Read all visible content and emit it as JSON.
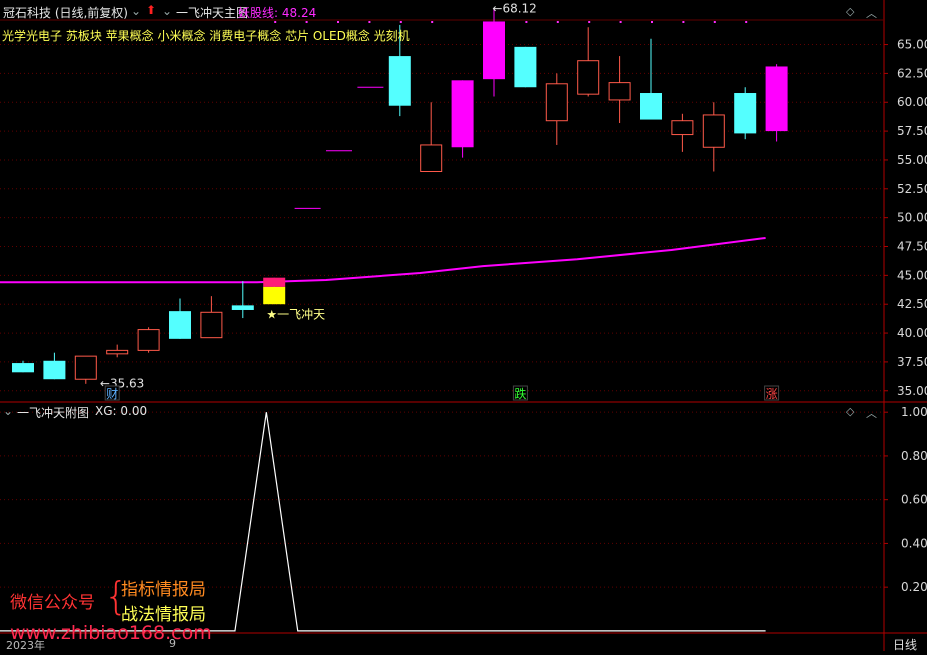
{
  "header": {
    "stock_title": "冠石科技 (日线,前复权)",
    "indicator_title": "一飞冲天主图",
    "indicator_value_label": "妖股线: 48.24",
    "concepts": "光学光电子 苏板块 苹果概念 小米概念 消费电子概念 芯片 OLED概念 光刻机",
    "sub_title": "一飞冲天附图",
    "sub_value": "XG: 0.00"
  },
  "watermark": {
    "left": "微信公众号",
    "line1": "指标情报局",
    "line2": "战法情报局",
    "url": "www.zhibiao168.com"
  },
  "bottom": {
    "year_label": "2023年",
    "month_label": "9",
    "period_button": "日线"
  },
  "colors": {
    "up": "#ff5a4a",
    "down": "#54ffff",
    "magenta": "#ff00ff",
    "pink": "#ff1a78",
    "yellow": "#ffff00",
    "axis": "#b00000",
    "dark_red_grid": "#600000"
  },
  "chart_data": [
    {
      "type": "candlestick",
      "y_ticks": [
        35.0,
        37.5,
        40.0,
        42.5,
        45.0,
        47.5,
        50.0,
        52.5,
        55.0,
        57.5,
        60.0,
        62.5,
        65.0
      ],
      "ylim": [
        34.2,
        67.3
      ],
      "candles": [
        {
          "o": 37.4,
          "h": 37.6,
          "l": 36.6,
          "c": 36.6,
          "color": "down"
        },
        {
          "o": 37.6,
          "h": 38.3,
          "l": 36.0,
          "c": 36.0,
          "color": "down"
        },
        {
          "o": 36.0,
          "h": 38.0,
          "l": 35.6,
          "c": 38.0,
          "color": "up"
        },
        {
          "o": 38.2,
          "h": 39.0,
          "l": 37.9,
          "c": 38.5,
          "color": "up"
        },
        {
          "o": 38.5,
          "h": 40.5,
          "l": 38.3,
          "c": 40.3,
          "color": "up"
        },
        {
          "o": 41.9,
          "h": 43.0,
          "l": 39.5,
          "c": 39.5,
          "color": "down"
        },
        {
          "o": 39.6,
          "h": 43.2,
          "l": 39.6,
          "c": 41.8,
          "color": "up"
        },
        {
          "o": 42.4,
          "h": 44.5,
          "l": 41.3,
          "c": 42.0,
          "color": "down"
        },
        {
          "o": 42.5,
          "h": 44.8,
          "l": 42.5,
          "c": 44.8,
          "color": "yiyi"
        },
        {
          "o": 50.8,
          "h": 50.8,
          "l": 50.8,
          "c": 50.8,
          "color": "magenta_dash"
        },
        {
          "o": 55.8,
          "h": 55.8,
          "l": 55.8,
          "c": 55.8,
          "color": "magenta_dash"
        },
        {
          "o": 61.3,
          "h": 61.3,
          "l": 61.3,
          "c": 61.3,
          "color": "magenta_dash"
        },
        {
          "o": 64.0,
          "h": 66.7,
          "l": 58.8,
          "c": 59.7,
          "color": "down"
        },
        {
          "o": 54.0,
          "h": 60.0,
          "l": 54.0,
          "c": 56.3,
          "color": "up"
        },
        {
          "o": 61.9,
          "h": 61.9,
          "l": 55.2,
          "c": 56.1,
          "color": "magenta"
        },
        {
          "o": 67.0,
          "h": 68.1,
          "l": 60.5,
          "c": 62.0,
          "color": "magenta"
        },
        {
          "o": 64.8,
          "h": 64.8,
          "l": 61.3,
          "c": 61.3,
          "color": "down"
        },
        {
          "o": 58.4,
          "h": 62.5,
          "l": 56.3,
          "c": 61.6,
          "color": "up"
        },
        {
          "o": 60.7,
          "h": 66.5,
          "l": 60.5,
          "c": 63.6,
          "color": "up"
        },
        {
          "o": 61.7,
          "h": 64.0,
          "l": 58.2,
          "c": 60.2,
          "color": "up"
        },
        {
          "o": 60.8,
          "h": 65.5,
          "l": 58.5,
          "c": 58.5,
          "color": "down"
        },
        {
          "o": 57.2,
          "h": 59.0,
          "l": 55.7,
          "c": 58.4,
          "color": "up"
        },
        {
          "o": 56.1,
          "h": 60.0,
          "l": 54.0,
          "c": 58.9,
          "color": "up"
        },
        {
          "o": 60.8,
          "h": 61.3,
          "l": 56.8,
          "c": 57.3,
          "color": "down"
        },
        {
          "o": 57.5,
          "h": 63.3,
          "l": 56.6,
          "c": 63.1,
          "color": "magenta"
        }
      ],
      "yaogu_line": {
        "name": "妖股线",
        "points": [
          [
            -0.4,
            44.4
          ],
          [
            7.8,
            44.4
          ],
          [
            10.0,
            44.6
          ],
          [
            13.0,
            45.2
          ],
          [
            15.0,
            45.8
          ],
          [
            18.0,
            46.4
          ],
          [
            21.0,
            47.2
          ],
          [
            24.0,
            48.24
          ]
        ]
      },
      "annotations": [
        {
          "text": "←35.63",
          "x": 2.8,
          "y": 35.63
        },
        {
          "text": "←68.12",
          "x": 15.3,
          "y": 68.12
        },
        {
          "text": "★一飞冲天",
          "x": 8.1,
          "y": 41.6
        }
      ],
      "markers": [
        {
          "text": "财",
          "x": 3.0,
          "color": "#5fb0ff"
        },
        {
          "text": "跌",
          "x": 16.0,
          "color": "#33ff33"
        },
        {
          "text": "涨",
          "x": 24.0,
          "color": "#ff4444"
        }
      ]
    },
    {
      "type": "line",
      "name": "XG",
      "y_ticks": [
        0.2,
        0.4,
        0.6,
        0.8,
        1.0
      ],
      "ylim": [
        -0.005,
        1.01
      ],
      "x": [
        -0.4,
        7.1,
        8.1,
        9.1,
        24.0
      ],
      "values": [
        0,
        0,
        1,
        0,
        0
      ]
    }
  ]
}
